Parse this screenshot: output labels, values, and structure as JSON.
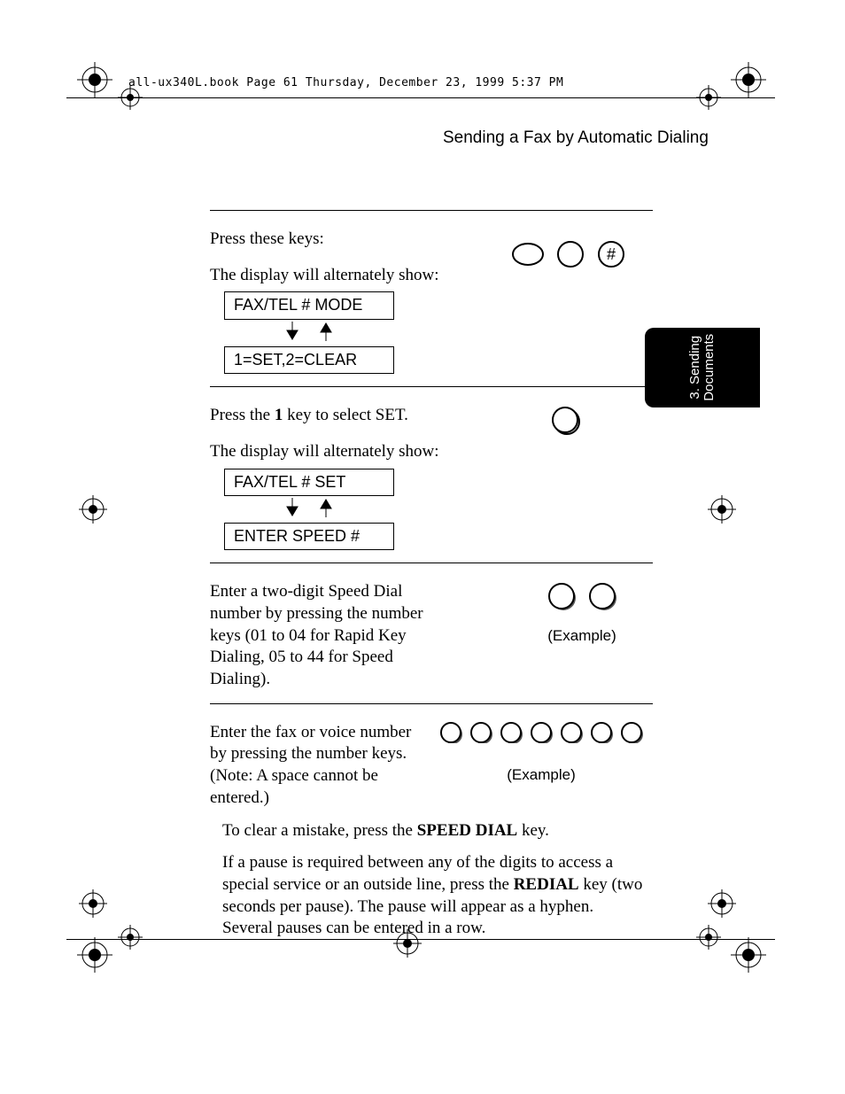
{
  "header": "all-ux340L.book  Page 61  Thursday, December 23, 1999  5:37 PM",
  "sectionTitle": "Sending a Fax by Automatic Dialing",
  "sidebarTab": "3. Sending\nDocuments",
  "step1": {
    "text1": "Press these keys:",
    "text2": "The display will alternately show:",
    "disp1": "FAX/TEL # MODE",
    "disp2": "1=SET,2=CLEAR"
  },
  "step2": {
    "text1a": "Press the ",
    "key": "1",
    "text1b": " key to select SET.",
    "text2": "The display will alternately show:",
    "disp1": "FAX/TEL # SET",
    "disp2": "ENTER SPEED #"
  },
  "step3": {
    "text": "Enter a two-digit Speed Dial number by pressing the number keys (01 to 04 for Rapid Key Dialing, 05 to 44 for Speed Dialing).",
    "example": "(Example)"
  },
  "step4": {
    "text1": "Enter the fax or voice number by pressing the number keys.",
    "text2": "(Note: A space cannot be entered.)",
    "sub1a": "To clear a mistake, press the ",
    "sub1bold": "SPEED DIAL",
    "sub1b": " key.",
    "sub2a": "If a pause is required between any of the digits to access a special service or an outside line, press the ",
    "sub2bold": "REDIAL",
    "sub2b": " key (two seconds per pause). The pause will appear as a hyphen. Several pauses can be entered in a row.",
    "example": "(Example)"
  }
}
